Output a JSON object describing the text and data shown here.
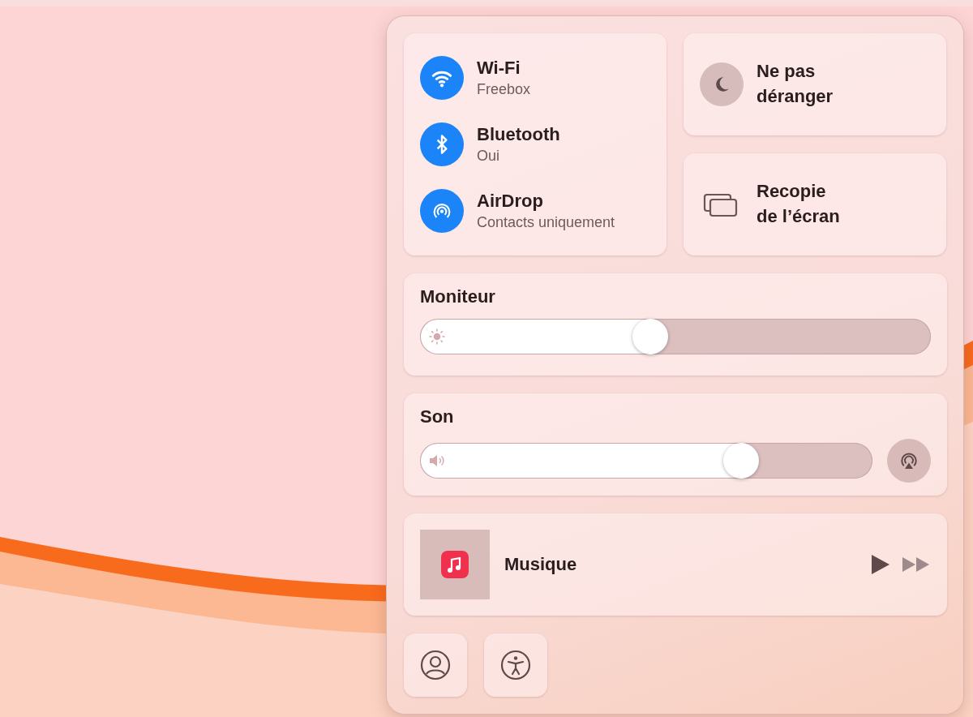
{
  "connectivity": [
    {
      "kind": "wifi",
      "title": "Wi-Fi",
      "subtitle": "Freebox",
      "on": true
    },
    {
      "kind": "bluetooth",
      "title": "Bluetooth",
      "subtitle": "Oui",
      "on": true
    },
    {
      "kind": "airdrop",
      "title": "AirDrop",
      "subtitle": "Contacts uniquement",
      "on": true
    }
  ],
  "focus": {
    "label": "Ne pas déranger",
    "on": false
  },
  "screen_mirroring": {
    "label": "Recopie de l’écran"
  },
  "display": {
    "title": "Moniteur",
    "level": 0.45
  },
  "sound": {
    "title": "Son",
    "level": 0.71
  },
  "now_playing": {
    "app": "Musique"
  },
  "bottom_buttons": [
    {
      "kind": "user"
    },
    {
      "kind": "accessibility"
    }
  ]
}
